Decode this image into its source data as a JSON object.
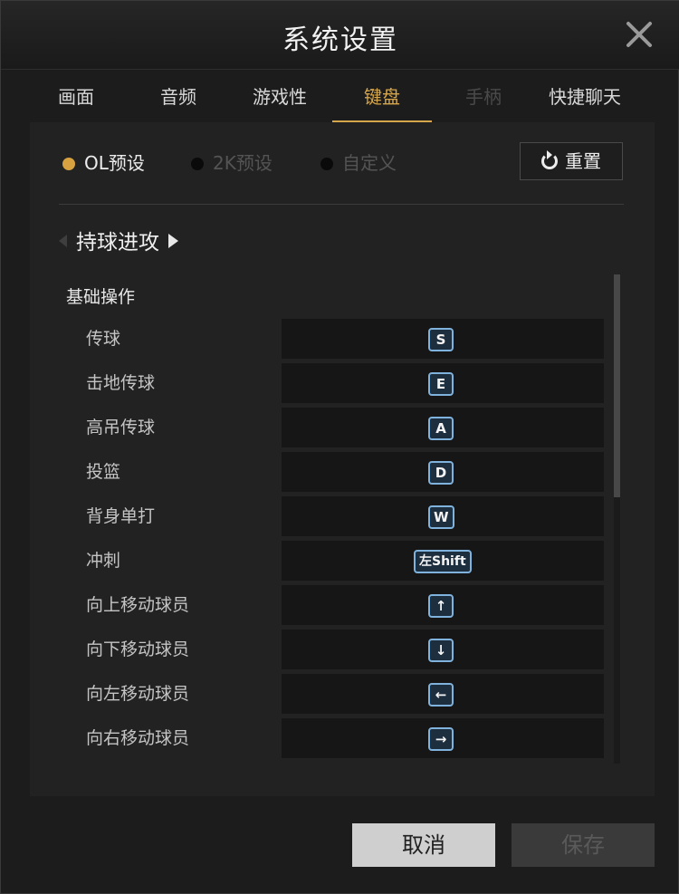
{
  "window": {
    "title": "系统设置"
  },
  "tabs": [
    {
      "label": "画面",
      "state": "normal"
    },
    {
      "label": "音频",
      "state": "normal"
    },
    {
      "label": "游戏性",
      "state": "normal"
    },
    {
      "label": "键盘",
      "state": "active"
    },
    {
      "label": "手柄",
      "state": "disabled"
    },
    {
      "label": "快捷聊天",
      "state": "normal"
    }
  ],
  "presets": {
    "options": [
      {
        "label": "OL预设",
        "selected": true
      },
      {
        "label": "2K预设",
        "selected": false
      },
      {
        "label": "自定义",
        "selected": false
      }
    ],
    "reset_label": "重置"
  },
  "section": {
    "title": "持球进攻"
  },
  "group": {
    "title": "基础操作"
  },
  "bindings": [
    {
      "action": "传球",
      "key": "S"
    },
    {
      "action": "击地传球",
      "key": "E"
    },
    {
      "action": "高吊传球",
      "key": "A"
    },
    {
      "action": "投篮",
      "key": "D"
    },
    {
      "action": "背身单打",
      "key": "W"
    },
    {
      "action": "冲刺",
      "key": "左Shift"
    },
    {
      "action": "向上移动球员",
      "key": "↑"
    },
    {
      "action": "向下移动球员",
      "key": "↓"
    },
    {
      "action": "向左移动球员",
      "key": "←"
    },
    {
      "action": "向右移动球员",
      "key": "→"
    }
  ],
  "footer": {
    "cancel_label": "取消",
    "save_label": "保存"
  },
  "colors": {
    "accent": "#d6a64a",
    "key_border": "#7fb2dc"
  }
}
